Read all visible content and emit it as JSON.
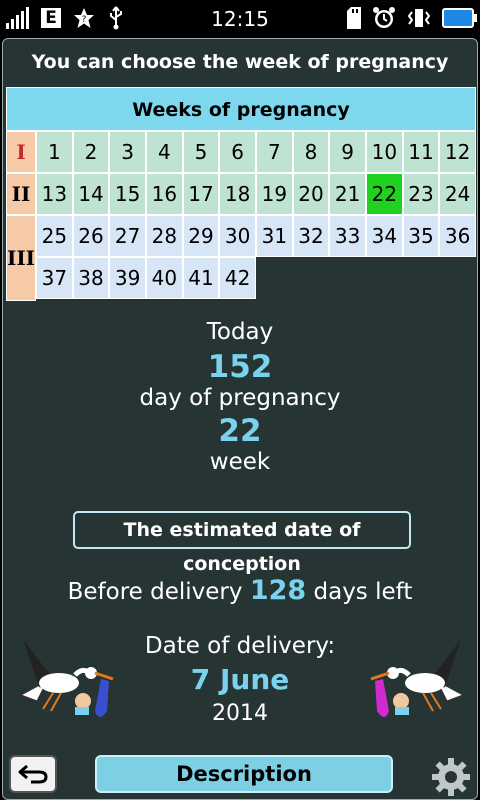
{
  "status_bar": {
    "network_type": "E",
    "time": "12:15"
  },
  "header": {
    "instruction": "You can choose the week of pregnancy"
  },
  "weeks_grid": {
    "title": "Weeks of pregnancy",
    "trimesters": [
      "I",
      "II",
      "III"
    ],
    "weeks": [
      "1",
      "2",
      "3",
      "4",
      "5",
      "6",
      "7",
      "8",
      "9",
      "10",
      "11",
      "12",
      "13",
      "14",
      "15",
      "16",
      "17",
      "18",
      "19",
      "20",
      "21",
      "22",
      "23",
      "24",
      "25",
      "26",
      "27",
      "28",
      "29",
      "30",
      "31",
      "32",
      "33",
      "34",
      "35",
      "36",
      "37",
      "38",
      "39",
      "40",
      "41",
      "42"
    ],
    "current_week": 22
  },
  "summary": {
    "today_label": "Today",
    "day_number": "152",
    "day_label": "day of pregnancy",
    "week_number": "22",
    "week_label": "week"
  },
  "conception_button": "The estimated date of conception",
  "before_delivery": {
    "prefix": "Before delivery",
    "days": "128",
    "suffix": "days left"
  },
  "delivery": {
    "label": "Date of delivery:",
    "date": "7 June",
    "year": "2014"
  },
  "bottom_bar": {
    "description_label": "Description"
  },
  "colors": {
    "accent_blue": "#7ad3ee",
    "current_week": "#1fd21f",
    "panel_bg": "#263533",
    "trimester_bg": "#f6c9a7"
  },
  "icons": [
    "signal-icon",
    "network-e-icon",
    "star-icon",
    "usb-icon",
    "sd-card-icon",
    "alarm-icon",
    "vibrate-icon",
    "battery-icon",
    "back-icon",
    "gear-icon",
    "stork-boy-icon",
    "stork-girl-icon"
  ]
}
